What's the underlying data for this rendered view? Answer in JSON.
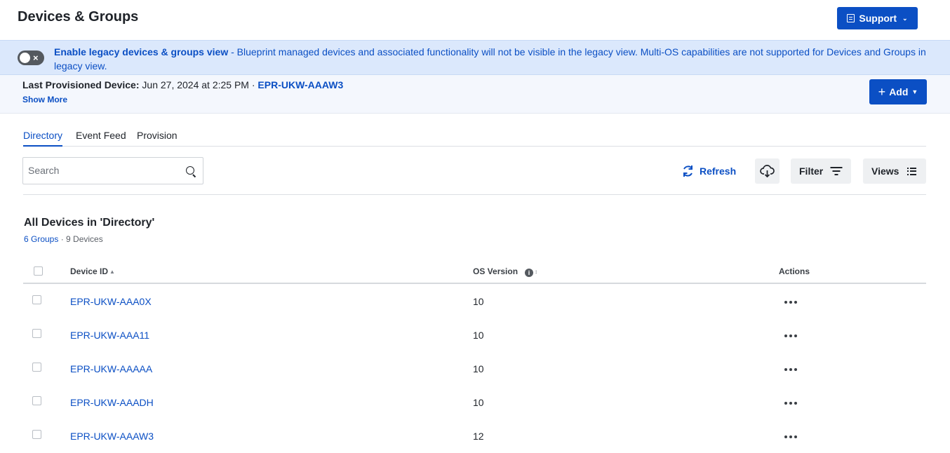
{
  "header": {
    "title": "Devices & Groups",
    "support_label": "Support"
  },
  "banner": {
    "toggle_state": "off",
    "link_text": "Enable legacy devices & groups view",
    "message": " - Blueprint managed devices and associated functionality will not be visible in the legacy view. Multi-OS capabilities are not supported for Devices and Groups in legacy view."
  },
  "provision": {
    "label": "Last Provisioned Device:",
    "date": " Jun 27, 2024 at 2:25 PM · ",
    "device_link": "EPR-UKW-AAAW3",
    "show_more": "Show More",
    "add_label": "Add"
  },
  "tabs": [
    {
      "label": "Directory",
      "active": true
    },
    {
      "label": "Event Feed",
      "active": false
    },
    {
      "label": "Provision",
      "active": false
    }
  ],
  "toolbar": {
    "search_placeholder": "Search",
    "refresh_label": "Refresh",
    "filter_label": "Filter",
    "views_label": "Views"
  },
  "section": {
    "title": "All Devices in 'Directory'",
    "groups_link": "6 Groups",
    "separator": " · ",
    "devices_count": "9 Devices"
  },
  "table": {
    "columns": {
      "device_id": "Device ID",
      "os_version": "OS Version",
      "actions": "Actions"
    },
    "rows": [
      {
        "device_id": "EPR-UKW-AAA0X",
        "os_version": "10"
      },
      {
        "device_id": "EPR-UKW-AAA11",
        "os_version": "10"
      },
      {
        "device_id": "EPR-UKW-AAAAA",
        "os_version": "10"
      },
      {
        "device_id": "EPR-UKW-AAADH",
        "os_version": "10"
      },
      {
        "device_id": "EPR-UKW-AAAW3",
        "os_version": "12"
      }
    ]
  },
  "colors": {
    "accent": "#0b4fc4",
    "banner_bg": "#dbe8fc",
    "provision_bg": "#f4f7fd",
    "button_gray": "#eef0f2"
  },
  "icons": {
    "support": "document-icon",
    "toggle": "toggle-off-icon",
    "search": "search-icon",
    "refresh": "refresh-icon",
    "cloud": "cloud-download-icon",
    "filter": "filter-icon",
    "views": "list-icon",
    "info": "info-icon",
    "actions": "ellipsis-icon"
  }
}
